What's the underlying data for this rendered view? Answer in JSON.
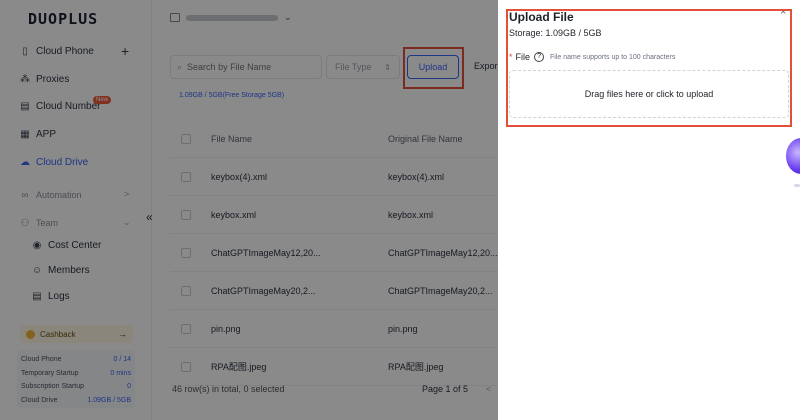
{
  "app": {
    "logo": "DUOPLUS"
  },
  "sidebar": {
    "items": [
      {
        "label": "Cloud Phone",
        "icon": "phone-icon"
      },
      {
        "label": "Proxies",
        "icon": "proxy-icon"
      },
      {
        "label": "Cloud Number",
        "icon": "number-icon",
        "badge": "New"
      },
      {
        "label": "APP",
        "icon": "grid-icon"
      },
      {
        "label": "Cloud Drive",
        "icon": "cloud-icon",
        "active": true
      },
      {
        "label": "Automation",
        "icon": "automation-icon"
      },
      {
        "label": "Team",
        "icon": "team-icon"
      },
      {
        "label": "Cost Center",
        "icon": "cost-icon"
      },
      {
        "label": "Members",
        "icon": "members-icon"
      },
      {
        "label": "Logs",
        "icon": "logs-icon"
      }
    ],
    "collapse_glyph": "«",
    "cashback": {
      "label": "Cashback",
      "arrow": "→"
    },
    "stats": [
      {
        "label": "Cloud Phone",
        "value": "0 / 14"
      },
      {
        "label": "Temporary Startup",
        "value": "0 mins"
      },
      {
        "label": "Subscription Startup",
        "value": "0"
      },
      {
        "label": "Cloud Drive",
        "value": "1.09GB / 5GB"
      }
    ]
  },
  "toolbar": {
    "search_placeholder": "Search by File Name",
    "file_type_placeholder": "File Type",
    "upload_label": "Upload",
    "export_label": "Expor",
    "storage_line": "1.09GB / 5GB(Free Storage 5GB)"
  },
  "table": {
    "headers": {
      "file_name": "File Name",
      "original_file_name": "Original File Name"
    },
    "rows": [
      {
        "file_name": "keybox(4).xml",
        "original": "keybox(4).xml"
      },
      {
        "file_name": "keybox.xml",
        "original": "keybox.xml"
      },
      {
        "file_name": "ChatGPTImageMay12,20...",
        "original": "ChatGPTImageMay12,20..."
      },
      {
        "file_name": "ChatGPTImageMay20,2...",
        "original": "ChatGPTImageMay20,2..."
      },
      {
        "file_name": "pin.png",
        "original": "pin.png"
      },
      {
        "file_name": "RPA配图.jpeg",
        "original": "RPA配图.jpeg"
      }
    ],
    "footer_total": "46 row(s) in total, 0 selected",
    "footer_page": "Page 1 of 5",
    "footer_prev": "<"
  },
  "drawer": {
    "title": "Upload File",
    "close": "×",
    "storage": "Storage: 1.09GB / 5GB",
    "file_required": "*",
    "file_label": "File",
    "file_hint": "File name supports up to 100 characters",
    "dropzone_text": "Drag files here or click to upload"
  },
  "colors": {
    "accent": "#3a63f5",
    "highlight": "#e2503a",
    "overlay": "rgba(0,0,0,0.46)"
  }
}
